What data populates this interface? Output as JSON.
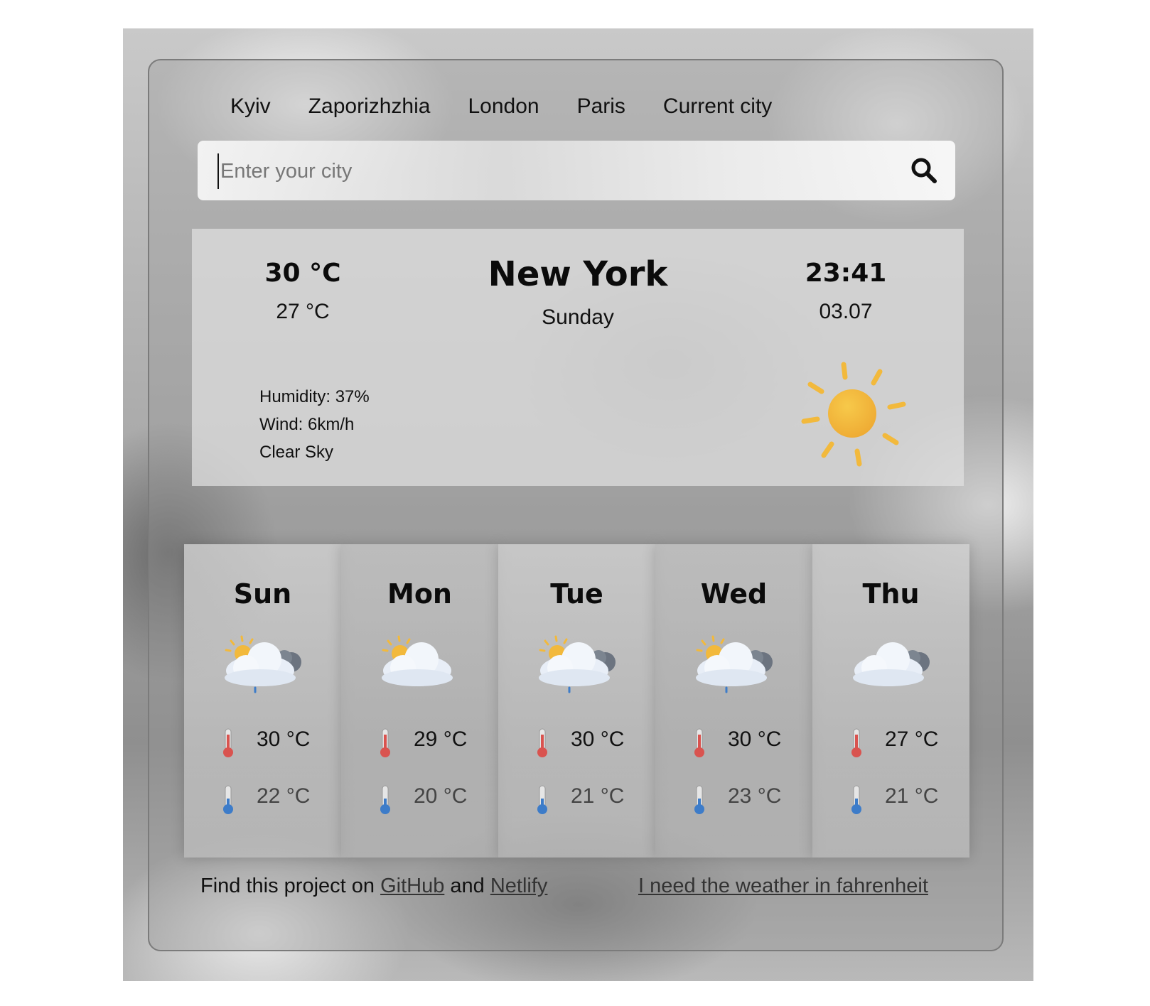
{
  "nav": {
    "cities": [
      "Kyiv",
      "Zaporizhzhia",
      "London",
      "Paris",
      "Current city"
    ]
  },
  "search": {
    "placeholder": "Enter your city",
    "value": "",
    "icon": "search-icon"
  },
  "current": {
    "temperature": "30 °C",
    "feels_like": "27 °C",
    "city": "New York",
    "weekday": "Sunday",
    "time": "23:41",
    "date": "03.07",
    "humidity": "Humidity: 37%",
    "wind": "Wind: 6km/h",
    "description": "Clear Sky",
    "icon": "sun-icon"
  },
  "forecast": [
    {
      "day": "Sun",
      "icon": "sun-cloud-rain-icon",
      "max": "30 °C",
      "min": "22 °C"
    },
    {
      "day": "Mon",
      "icon": "sun-cloud-icon",
      "max": "29 °C",
      "min": "20 °C"
    },
    {
      "day": "Tue",
      "icon": "sun-cloud-rain-icon",
      "max": "30 °C",
      "min": "21 °C"
    },
    {
      "day": "Wed",
      "icon": "sun-cloud-rain-icon",
      "max": "30 °C",
      "min": "23 °C"
    },
    {
      "day": "Thu",
      "icon": "cloud-icon",
      "max": "27 °C",
      "min": "21 °C"
    }
  ],
  "footer": {
    "text_before": "Find this project on ",
    "github": "GitHub",
    "and": " and ",
    "netlify": "Netlify",
    "fahrenheit_link": "I need the weather in fahrenheit"
  },
  "colors": {
    "sun": "#f2b93c",
    "thermometer_hot": "#d9534f",
    "thermometer_cold": "#3d7cc9"
  }
}
